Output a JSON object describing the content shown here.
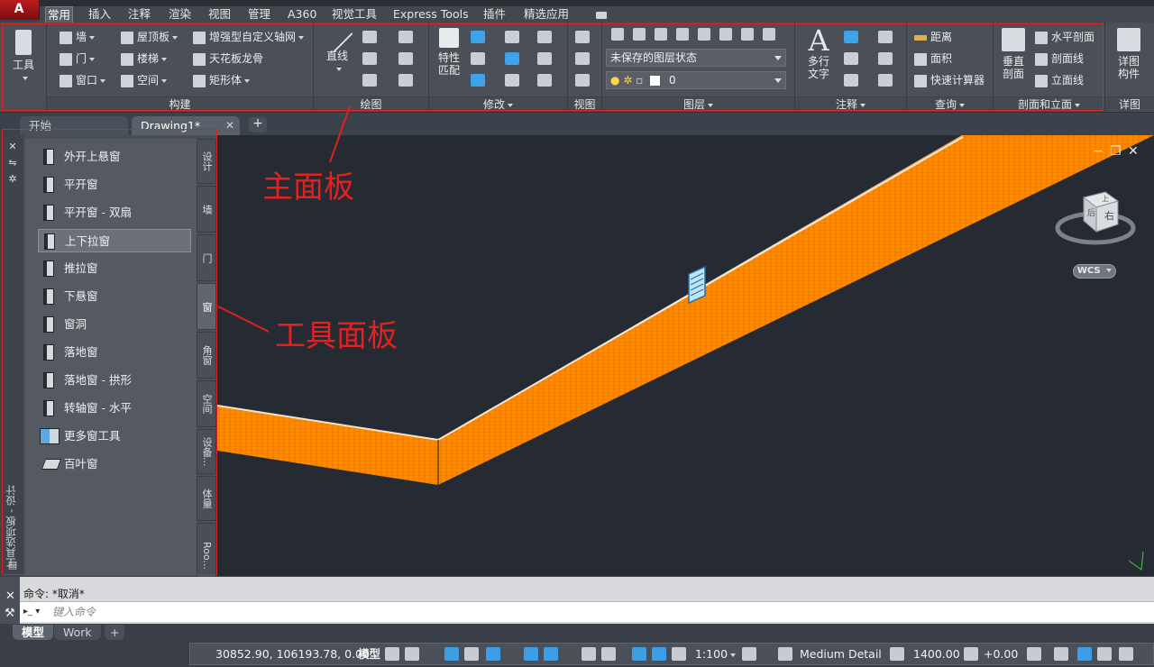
{
  "menu": {
    "tabs": [
      "常用",
      "插入",
      "注释",
      "渲染",
      "视图",
      "管理",
      "A360",
      "视觉工具",
      "Express Tools",
      "插件",
      "精选应用"
    ]
  },
  "ribbon": {
    "tool_label": "工具",
    "build": {
      "title": "构建",
      "wall": "墙",
      "door": "门",
      "window": "窗口",
      "roof_slab": "屋顶板",
      "stair": "楼梯",
      "space": "空间",
      "grid": "增强型自定义轴网",
      "ceiling": "天花板龙骨",
      "mass": "矩形体"
    },
    "draw": {
      "title": "绘图",
      "line": "直线"
    },
    "modify": {
      "title": "修改",
      "properties": "特性",
      "match": "匹配"
    },
    "view": {
      "title": "视图"
    },
    "layers": {
      "title": "图层",
      "layer_state": "未保存的图层状态",
      "current_layer": "0"
    },
    "annotation": {
      "title": "注释",
      "mtext_1": "多行",
      "mtext_2": "文字"
    },
    "inquiry": {
      "title": "查询",
      "distance": "距离",
      "area": "面积",
      "calc": "快速计算器"
    },
    "section": {
      "title": "剖面和立面",
      "vertical_1": "垂直",
      "vertical_2": "剖面",
      "horizontal": "水平剖面",
      "section_line": "剖面线",
      "elevation_line": "立面线"
    },
    "detail": {
      "title": "详图",
      "label_1": "详图",
      "label_2": "构件"
    }
  },
  "doc_tabs": {
    "start": "开始",
    "drawing": "Drawing1*",
    "close": "✕",
    "add": "+"
  },
  "palette": {
    "vertical_title": "工具选项板 - 设计",
    "items": [
      "外开上悬窗",
      "平开窗",
      "平开窗 - 双扇",
      "上下拉窗",
      "推拉窗",
      "下悬窗",
      "窗洞",
      "落地窗",
      "落地窗 - 拱形",
      "转轴窗 - 水平",
      "更多窗工具",
      "百叶窗"
    ],
    "selected_index": 3,
    "side_tabs": [
      "设计",
      "墙",
      "门",
      "窗",
      "角窗",
      "空间",
      "设备...",
      "体量",
      "Roo..."
    ],
    "active_side_tab": 3
  },
  "viewport": {
    "controls": [
      "−",
      "❐",
      "✕"
    ],
    "viewcube": {
      "face": "右",
      "top": "上",
      "side": "后",
      "wcs": "WCS"
    }
  },
  "annotations": {
    "main_panel": "主面板",
    "tool_panel": "工具面板"
  },
  "command": {
    "history": "命令: *取消*",
    "placeholder": "键入命令"
  },
  "layout_tabs": [
    "模型",
    "Work",
    "+"
  ],
  "status": {
    "coords": "30852.90, 106193.78, 0.00",
    "space": "模型",
    "scale": "1:100",
    "detail": "Medium Detail",
    "elevation": "1400.00",
    "offset": "+0.00"
  },
  "colors": {
    "accent": "#e02020",
    "wall": "#ff8a00",
    "viewport_bg": "#252a33"
  }
}
